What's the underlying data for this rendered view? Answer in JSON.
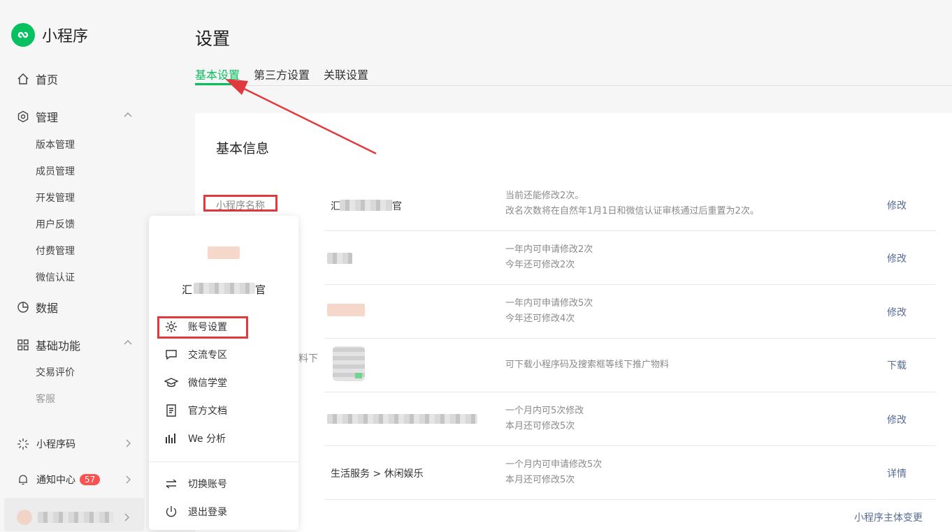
{
  "app": {
    "name": "小程序",
    "brand_color": "#07c160"
  },
  "sidebar": {
    "home": "首页",
    "manage": {
      "label": "管理",
      "items": [
        "版本管理",
        "成员管理",
        "开发管理",
        "用户反馈",
        "付费管理",
        "微信认证"
      ]
    },
    "data": "数据",
    "basic": {
      "label": "基础功能",
      "items": [
        "交易评价",
        "客服"
      ]
    },
    "miniprogram_code": "小程序码",
    "notify": {
      "label": "通知中心",
      "count": "57"
    }
  },
  "page": {
    "title": "设置",
    "tabs": [
      "基本设置",
      "第三方设置",
      "关联设置"
    ]
  },
  "card": {
    "title": "基本信息",
    "rows": [
      {
        "label": "小程序名称",
        "value_prefix": "汇",
        "value_suffix": "官",
        "desc1": "当前还能修改2次。",
        "desc2": "改名次数将在自然年1月1日和微信认证审核通过后重置为2次。",
        "action": "修改"
      },
      {
        "desc1": "一年内可申请修改2次",
        "desc2": "今年还可修改2次",
        "action": "修改"
      },
      {
        "desc1": "一年内可申请修改5次",
        "desc2": "今年还可修改4次",
        "action": "修改"
      },
      {
        "label_tail": "料下",
        "desc1": "可下载小程序码及搜索框等线下推广物料",
        "action": "下载"
      },
      {
        "desc1": "一个月内可5次修改",
        "desc2": "本月还可修改5次",
        "action": "修改"
      },
      {
        "value": "生活服务 > 休闲娱乐",
        "desc1": "一个月内可申请修改5次",
        "desc2": "本月还可修改5次",
        "action": "详情"
      }
    ],
    "footer_link": "小程序主体变更"
  },
  "popup": {
    "name_prefix": "汇",
    "name_suffix": "官",
    "items": [
      "账号设置",
      "交流专区",
      "微信学堂",
      "官方文档",
      "We 分析"
    ],
    "bottom": [
      "切换账号",
      "退出登录"
    ]
  },
  "annotation_color": "#e0393e"
}
